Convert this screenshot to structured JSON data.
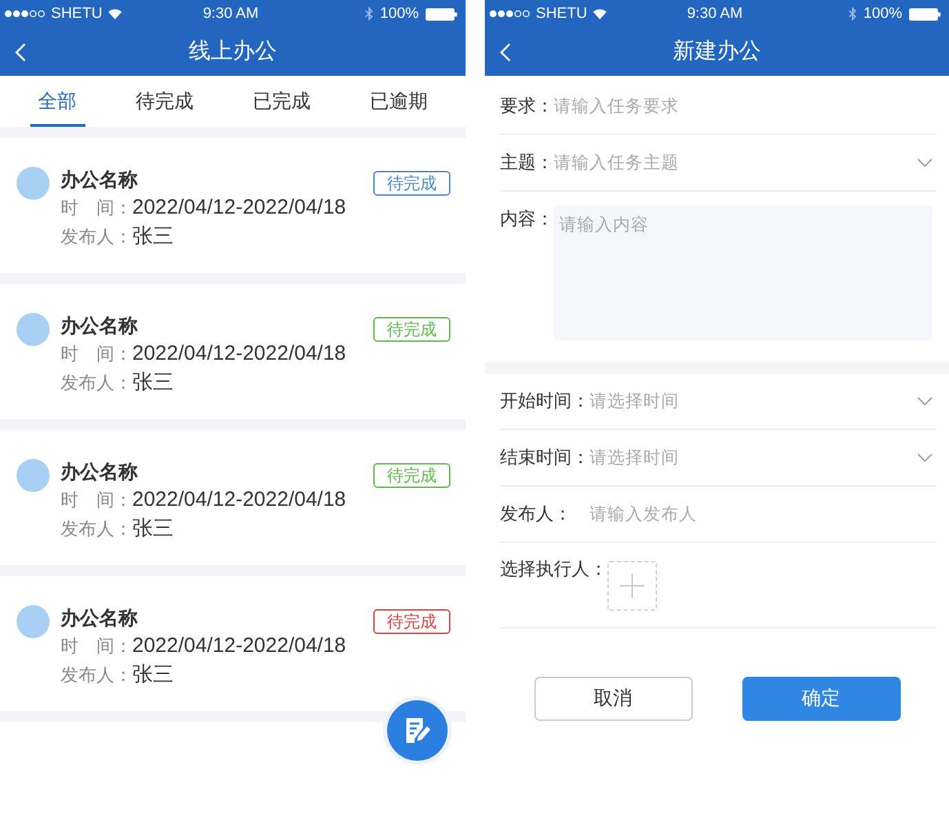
{
  "list_screen": {
    "status_bar": {
      "carrier": "SHETU",
      "time": "9:30 AM",
      "battery": "100%"
    },
    "nav_bar": {
      "title": "线上办公"
    },
    "tabs": [
      {
        "label": "全部",
        "selected": true
      },
      {
        "label": "待完成",
        "selected": false
      },
      {
        "label": "已完成",
        "selected": false
      },
      {
        "label": "已逾期",
        "selected": false
      }
    ],
    "tasks": [
      {
        "title": "办公名称",
        "time_label": "时　间：",
        "time": "2022/04/12-2022/04/18",
        "publisher_label": "发布人：",
        "publisher": "张三",
        "status": "待完成",
        "color": "#4a86cf"
      },
      {
        "title": "办公名称",
        "time_label": "时　间：",
        "time": "2022/04/12-2022/04/18",
        "publisher_label": "发布人：",
        "publisher": "张三",
        "status": "待完成",
        "color": "#5cbb4a"
      },
      {
        "title": "办公名称",
        "time_label": "时　间：",
        "time": "2022/04/12-2022/04/18",
        "publisher_label": "发布人：",
        "publisher": "张三",
        "status": "待完成",
        "color": "#5cbb4a"
      },
      {
        "title": "办公名称",
        "time_label": "时　间：",
        "time": "2022/04/12-2022/04/18",
        "publisher_label": "发布人：",
        "publisher": "张三",
        "status": "待完成",
        "color": "#d9403f"
      }
    ]
  },
  "form_screen": {
    "status_bar": {
      "carrier": "SHETU",
      "time": "9:30 AM",
      "battery": "100%"
    },
    "nav_bar": {
      "title": "新建办公"
    },
    "sections": [
      {
        "fields": [
          {
            "kind": "input",
            "label": "要求：",
            "placeholder": "请输入任务要求"
          },
          {
            "kind": "select",
            "label": "主题：",
            "placeholder": "请输入任务主题"
          },
          {
            "kind": "textarea",
            "label": "内容：",
            "placeholder": "请输入内容"
          }
        ]
      },
      {
        "fields": [
          {
            "kind": "select",
            "label": "开始时间：",
            "placeholder": "请选择时间"
          },
          {
            "kind": "select",
            "label": "结束时间：",
            "placeholder": "请选择时间"
          },
          {
            "kind": "input",
            "label": "发布人：",
            "placeholder": "请输入发布人"
          },
          {
            "kind": "picker",
            "label": "选择执行人："
          }
        ]
      }
    ],
    "buttons": [
      {
        "label": "取消",
        "kind": "secondary"
      },
      {
        "label": "确定",
        "kind": "primary"
      }
    ]
  }
}
